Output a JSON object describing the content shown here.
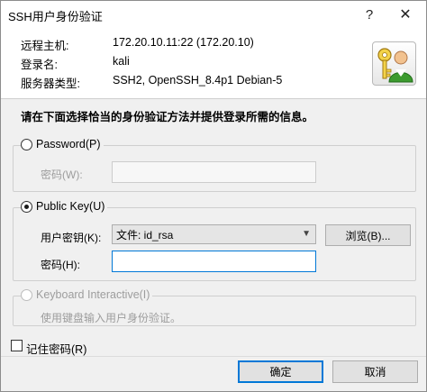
{
  "window": {
    "title": "SSH用户身份验证",
    "help_glyph": "?",
    "close_glyph": "✕"
  },
  "info": {
    "host_label": "远程主机:",
    "host_value": "172.20.10.11:22 (172.20.10)",
    "login_label": "登录名:",
    "login_value": "kali",
    "server_label": "服务器类型:",
    "server_value": "SSH2, OpenSSH_8.4p1 Debian-5",
    "icon": "key-user-icon"
  },
  "instruction": "请在下面选择恰当的身份验证方法并提供登录所需的信息。",
  "password_method": {
    "label": "Password(P)",
    "selected": false,
    "password_label": "密码(W):",
    "password_value": ""
  },
  "publickey_method": {
    "label": "Public Key(U)",
    "selected": true,
    "user_key_label": "用户密钥(K):",
    "user_key_value": "文件: id_rsa",
    "browse_label": "浏览(B)...",
    "passphrase_label": "密码(H):",
    "passphrase_value": ""
  },
  "keyboard_method": {
    "label": "Keyboard Interactive(I)",
    "selected": false,
    "enabled": false,
    "description": "使用键盘输入用户身份验证。"
  },
  "remember": {
    "label": "记住密码(R)",
    "checked": false
  },
  "buttons": {
    "ok": "确定",
    "cancel": "取消"
  },
  "colors": {
    "accent": "#0078d7",
    "dialog_bg": "#f0f0f0",
    "disabled_text": "#9d9d9d"
  }
}
